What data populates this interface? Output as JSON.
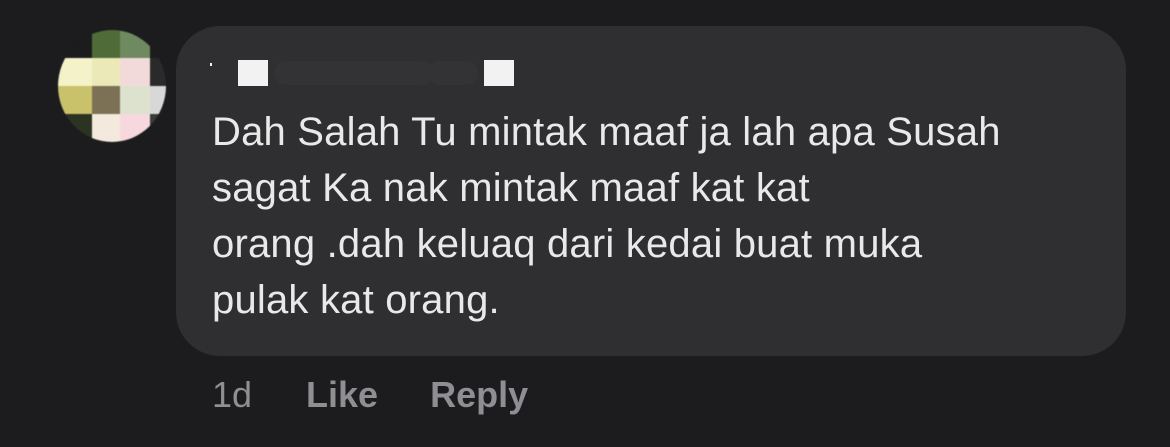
{
  "comment": {
    "author_name": "",
    "text_lines": [
      "Dah Salah Tu mintak maaf ja lah apa Susah",
      "sagat Ka nak mintak maaf kat kat",
      "orang .dah keluaq dari kedai buat muka",
      "pulak kat orang."
    ],
    "timestamp": "1d",
    "like_label": "Like",
    "reply_label": "Reply"
  },
  "colors": {
    "background": "#1c1c1e",
    "bubble": "#2f2f31",
    "text": "#e9e9ea",
    "meta": "#8e8e93"
  }
}
